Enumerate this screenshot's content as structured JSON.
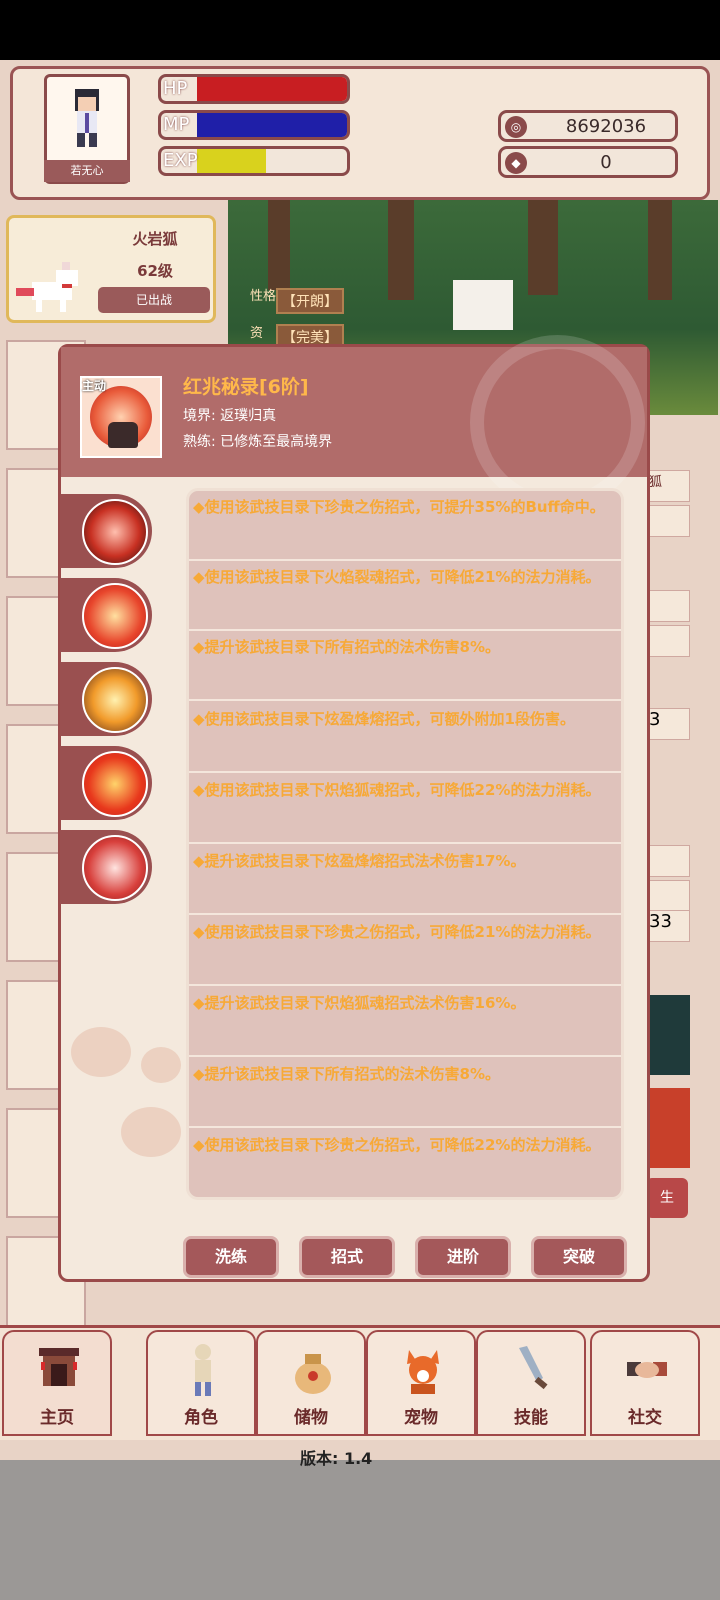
{
  "header": {
    "player_name": "若无心",
    "bars": [
      {
        "label": "HP",
        "fill_fraction": 1.0,
        "color": "#c81e22"
      },
      {
        "label": "MP",
        "fill_fraction": 1.0,
        "color": "#1f1fa8"
      },
      {
        "label": "EXP",
        "fill_fraction": 0.46,
        "color": "#d9d21d"
      }
    ],
    "currency": [
      {
        "icon": "coin-icon",
        "value": "8692036"
      },
      {
        "icon": "gem-icon",
        "value": "0"
      }
    ]
  },
  "pet": {
    "name": "火岩狐",
    "level": "62级",
    "status_button": "已出战"
  },
  "scene": {
    "trait_label": "性格",
    "trait_value": "【开朗】",
    "aptitude_label": "资",
    "aptitude_value": "【完美】"
  },
  "modal": {
    "skill_tag": "主动",
    "skill_title": "红兆秘录[6阶]",
    "realm": "境界: 返璞归真",
    "mastery": "熟练: 已修炼至最高境界",
    "descriptions": [
      "◆使用该武技目录下珍贵之伤招式，可提升35%的Buff命中。",
      "◆使用该武技目录下火焰裂魂招式，可降低21%的法力消耗。",
      "◆提升该武技目录下所有招式的法术伤害8%。",
      "◆使用该武技目录下炫盈烽熔招式，可额外附加1段伤害。",
      "◆使用该武技目录下炽焰狐魂招式，可降低22%的法力消耗。",
      "◆提升该武技目录下炫盈烽熔招式法术伤害17%。",
      "◆使用该武技目录下珍贵之伤招式，可降低21%的法力消耗。",
      "◆提升该武技目录下炽焰狐魂招式法术伤害16%。",
      "◆提升该武技目录下所有招式的法术伤害8%。",
      "◆使用该武技目录下珍贵之伤招式，可降低22%的法力消耗。"
    ],
    "buttons": [
      "洗练",
      "招式",
      "进阶",
      "突破"
    ]
  },
  "nav": [
    {
      "label": "主页",
      "icon": "gate-icon"
    },
    {
      "label": "角色",
      "icon": "figure-icon"
    },
    {
      "label": "储物",
      "icon": "bag-icon"
    },
    {
      "label": "宠物",
      "icon": "fox-icon"
    },
    {
      "label": "技能",
      "icon": "sword-icon"
    },
    {
      "label": "社交",
      "icon": "handshake-icon"
    }
  ],
  "version": "版本: 1.4",
  "partial_texts": {
    "right_peek_1": "3",
    "right_peek_2": "33",
    "right_peek_3": "生",
    "right_peek_4": "狐"
  }
}
